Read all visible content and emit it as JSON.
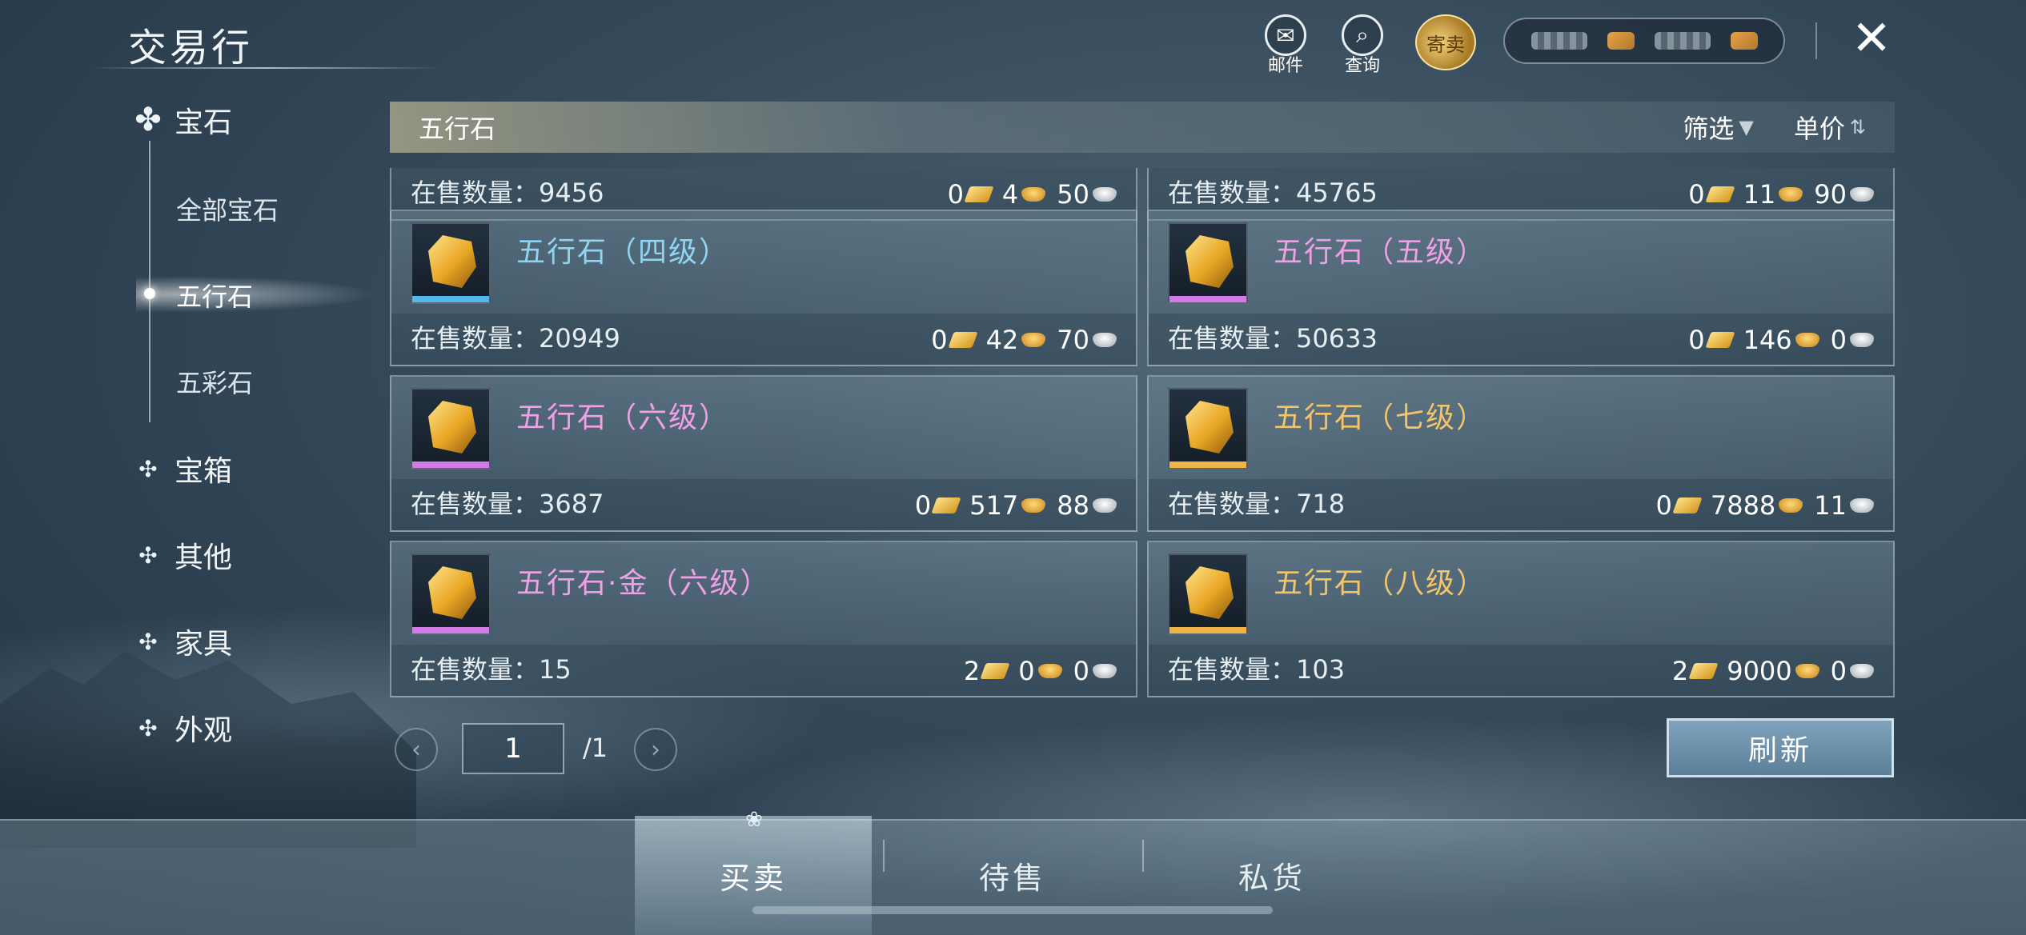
{
  "header": {
    "title": "交易行",
    "mail_label": "邮件",
    "query_label": "查询",
    "consign_label": "寄卖"
  },
  "sidebar": {
    "categories": [
      {
        "label": "宝石"
      },
      {
        "label": "宝箱"
      },
      {
        "label": "其他"
      },
      {
        "label": "家具"
      },
      {
        "label": "外观"
      }
    ],
    "subitems": [
      {
        "label": "全部宝石"
      },
      {
        "label": "五行石"
      },
      {
        "label": "五彩石"
      }
    ],
    "active_subitem": "五行石"
  },
  "filter_bar": {
    "category": "五行石",
    "filter_label": "筛选",
    "sort_label": "单价"
  },
  "listings": [
    {
      "name": "",
      "qty_label": "在售数量：9456",
      "price": [
        "0",
        "4",
        "50"
      ],
      "rarity": "blue",
      "partial": true
    },
    {
      "name": "",
      "qty_label": "在售数量：45765",
      "price": [
        "0",
        "11",
        "90"
      ],
      "rarity": "blue",
      "partial": true
    },
    {
      "name": "五行石（四级）",
      "qty_label": "在售数量：20949",
      "price": [
        "0",
        "42",
        "70"
      ],
      "rarity": "blue"
    },
    {
      "name": "五行石（五级）",
      "qty_label": "在售数量：50633",
      "price": [
        "0",
        "146",
        "0"
      ],
      "rarity": "purple"
    },
    {
      "name": "五行石（六级）",
      "qty_label": "在售数量：3687",
      "price": [
        "0",
        "517",
        "88"
      ],
      "rarity": "purple"
    },
    {
      "name": "五行石（七级）",
      "qty_label": "在售数量：718",
      "price": [
        "0",
        "7888",
        "11"
      ],
      "rarity": "gold"
    },
    {
      "name": "五行石·金（六级）",
      "qty_label": "在售数量：15",
      "price": [
        "2",
        "0",
        "0"
      ],
      "rarity": "purple"
    },
    {
      "name": "五行石（八级）",
      "qty_label": "在售数量：103",
      "price": [
        "2",
        "9000",
        "0"
      ],
      "rarity": "gold"
    }
  ],
  "pager": {
    "current": "1",
    "total": "/1",
    "refresh_label": "刷新"
  },
  "tabs": [
    {
      "label": "买卖",
      "active": true
    },
    {
      "label": "待售",
      "active": false
    },
    {
      "label": "私货",
      "active": false
    }
  ],
  "colors": {
    "rarity_blue": "#54b7ea",
    "rarity_purple": "#d27ae8",
    "rarity_gold": "#f0b348"
  }
}
